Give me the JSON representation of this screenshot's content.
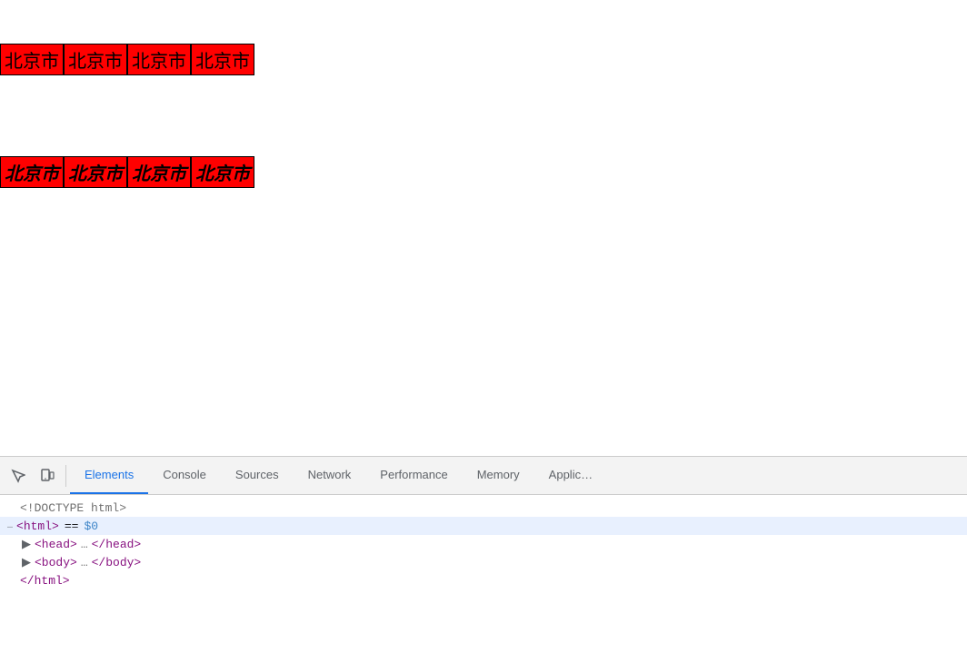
{
  "main": {
    "textRow1": [
      "北京市",
      "北京市",
      "北京市",
      "北京市"
    ],
    "textRow2": [
      "北京市",
      "北京市",
      "北京市",
      "北京市"
    ]
  },
  "devtools": {
    "tabs": [
      {
        "id": "elements",
        "label": "Elements",
        "active": true
      },
      {
        "id": "console",
        "label": "Console",
        "active": false
      },
      {
        "id": "sources",
        "label": "Sources",
        "active": false
      },
      {
        "id": "network",
        "label": "Network",
        "active": false
      },
      {
        "id": "performance",
        "label": "Performance",
        "active": false
      },
      {
        "id": "memory",
        "label": "Memory",
        "active": false
      },
      {
        "id": "application",
        "label": "Applic…",
        "active": false
      }
    ],
    "dom": {
      "doctype": "<!DOCTYPE html>",
      "htmlTag": "<html>",
      "htmlEquals": "==",
      "htmlDollar": "$0",
      "headTag": "▶ <head>…</head>",
      "bodyTag": "▶ <body>…</body>",
      "htmlClose": "</html>"
    }
  }
}
